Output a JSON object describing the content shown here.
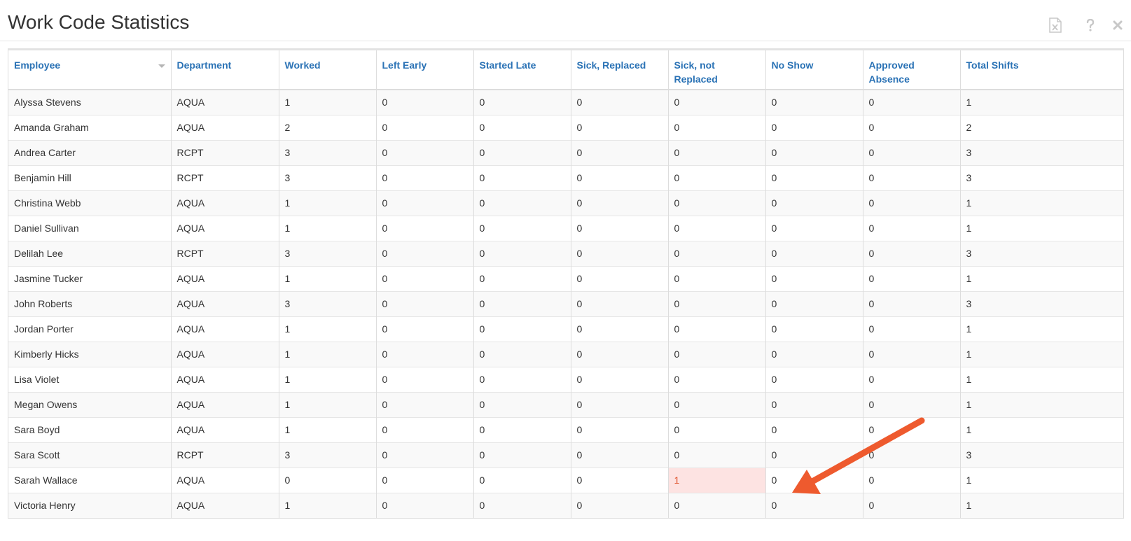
{
  "header": {
    "title": "Work Code Statistics",
    "icons": [
      "excel-export-icon",
      "help-icon",
      "close-icon"
    ],
    "icon_color": "#c8c8c8"
  },
  "table": {
    "columns": [
      "Employee",
      "Department",
      "Worked",
      "Left Early",
      "Started Late",
      "Sick, Replaced",
      "Sick, not Replaced",
      "No Show",
      "Approved Absence",
      "Total Shifts"
    ],
    "sorted_column": "Employee",
    "rows": [
      [
        "Alyssa Stevens",
        "AQUA",
        "1",
        "0",
        "0",
        "0",
        "0",
        "0",
        "0",
        "1"
      ],
      [
        "Amanda Graham",
        "AQUA",
        "2",
        "0",
        "0",
        "0",
        "0",
        "0",
        "0",
        "2"
      ],
      [
        "Andrea Carter",
        "RCPT",
        "3",
        "0",
        "0",
        "0",
        "0",
        "0",
        "0",
        "3"
      ],
      [
        "Benjamin Hill",
        "RCPT",
        "3",
        "0",
        "0",
        "0",
        "0",
        "0",
        "0",
        "3"
      ],
      [
        "Christina Webb",
        "AQUA",
        "1",
        "0",
        "0",
        "0",
        "0",
        "0",
        "0",
        "1"
      ],
      [
        "Daniel Sullivan",
        "AQUA",
        "1",
        "0",
        "0",
        "0",
        "0",
        "0",
        "0",
        "1"
      ],
      [
        "Delilah Lee",
        "RCPT",
        "3",
        "0",
        "0",
        "0",
        "0",
        "0",
        "0",
        "3"
      ],
      [
        "Jasmine Tucker",
        "AQUA",
        "1",
        "0",
        "0",
        "0",
        "0",
        "0",
        "0",
        "1"
      ],
      [
        "John Roberts",
        "AQUA",
        "3",
        "0",
        "0",
        "0",
        "0",
        "0",
        "0",
        "3"
      ],
      [
        "Jordan Porter",
        "AQUA",
        "1",
        "0",
        "0",
        "0",
        "0",
        "0",
        "0",
        "1"
      ],
      [
        "Kimberly Hicks",
        "AQUA",
        "1",
        "0",
        "0",
        "0",
        "0",
        "0",
        "0",
        "1"
      ],
      [
        "Lisa Violet",
        "AQUA",
        "1",
        "0",
        "0",
        "0",
        "0",
        "0",
        "0",
        "1"
      ],
      [
        "Megan Owens",
        "AQUA",
        "1",
        "0",
        "0",
        "0",
        "0",
        "0",
        "0",
        "1"
      ],
      [
        "Sara Boyd",
        "AQUA",
        "1",
        "0",
        "0",
        "0",
        "0",
        "0",
        "0",
        "1"
      ],
      [
        "Sara Scott",
        "RCPT",
        "3",
        "0",
        "0",
        "0",
        "0",
        "0",
        "0",
        "3"
      ],
      [
        "Sarah Wallace",
        "AQUA",
        "0",
        "0",
        "0",
        "0",
        "1",
        "0",
        "0",
        "1"
      ],
      [
        "Victoria Henry",
        "AQUA",
        "1",
        "0",
        "0",
        "0",
        "0",
        "0",
        "0",
        "1"
      ]
    ],
    "highlighted_cell": {
      "row": 15,
      "column": 6
    },
    "colors": {
      "header_text": "#2a72b5",
      "highlight_bg": "#fde3e2",
      "highlight_text": "#e0562f",
      "annotation_arrow": "#ee5a2e"
    }
  }
}
